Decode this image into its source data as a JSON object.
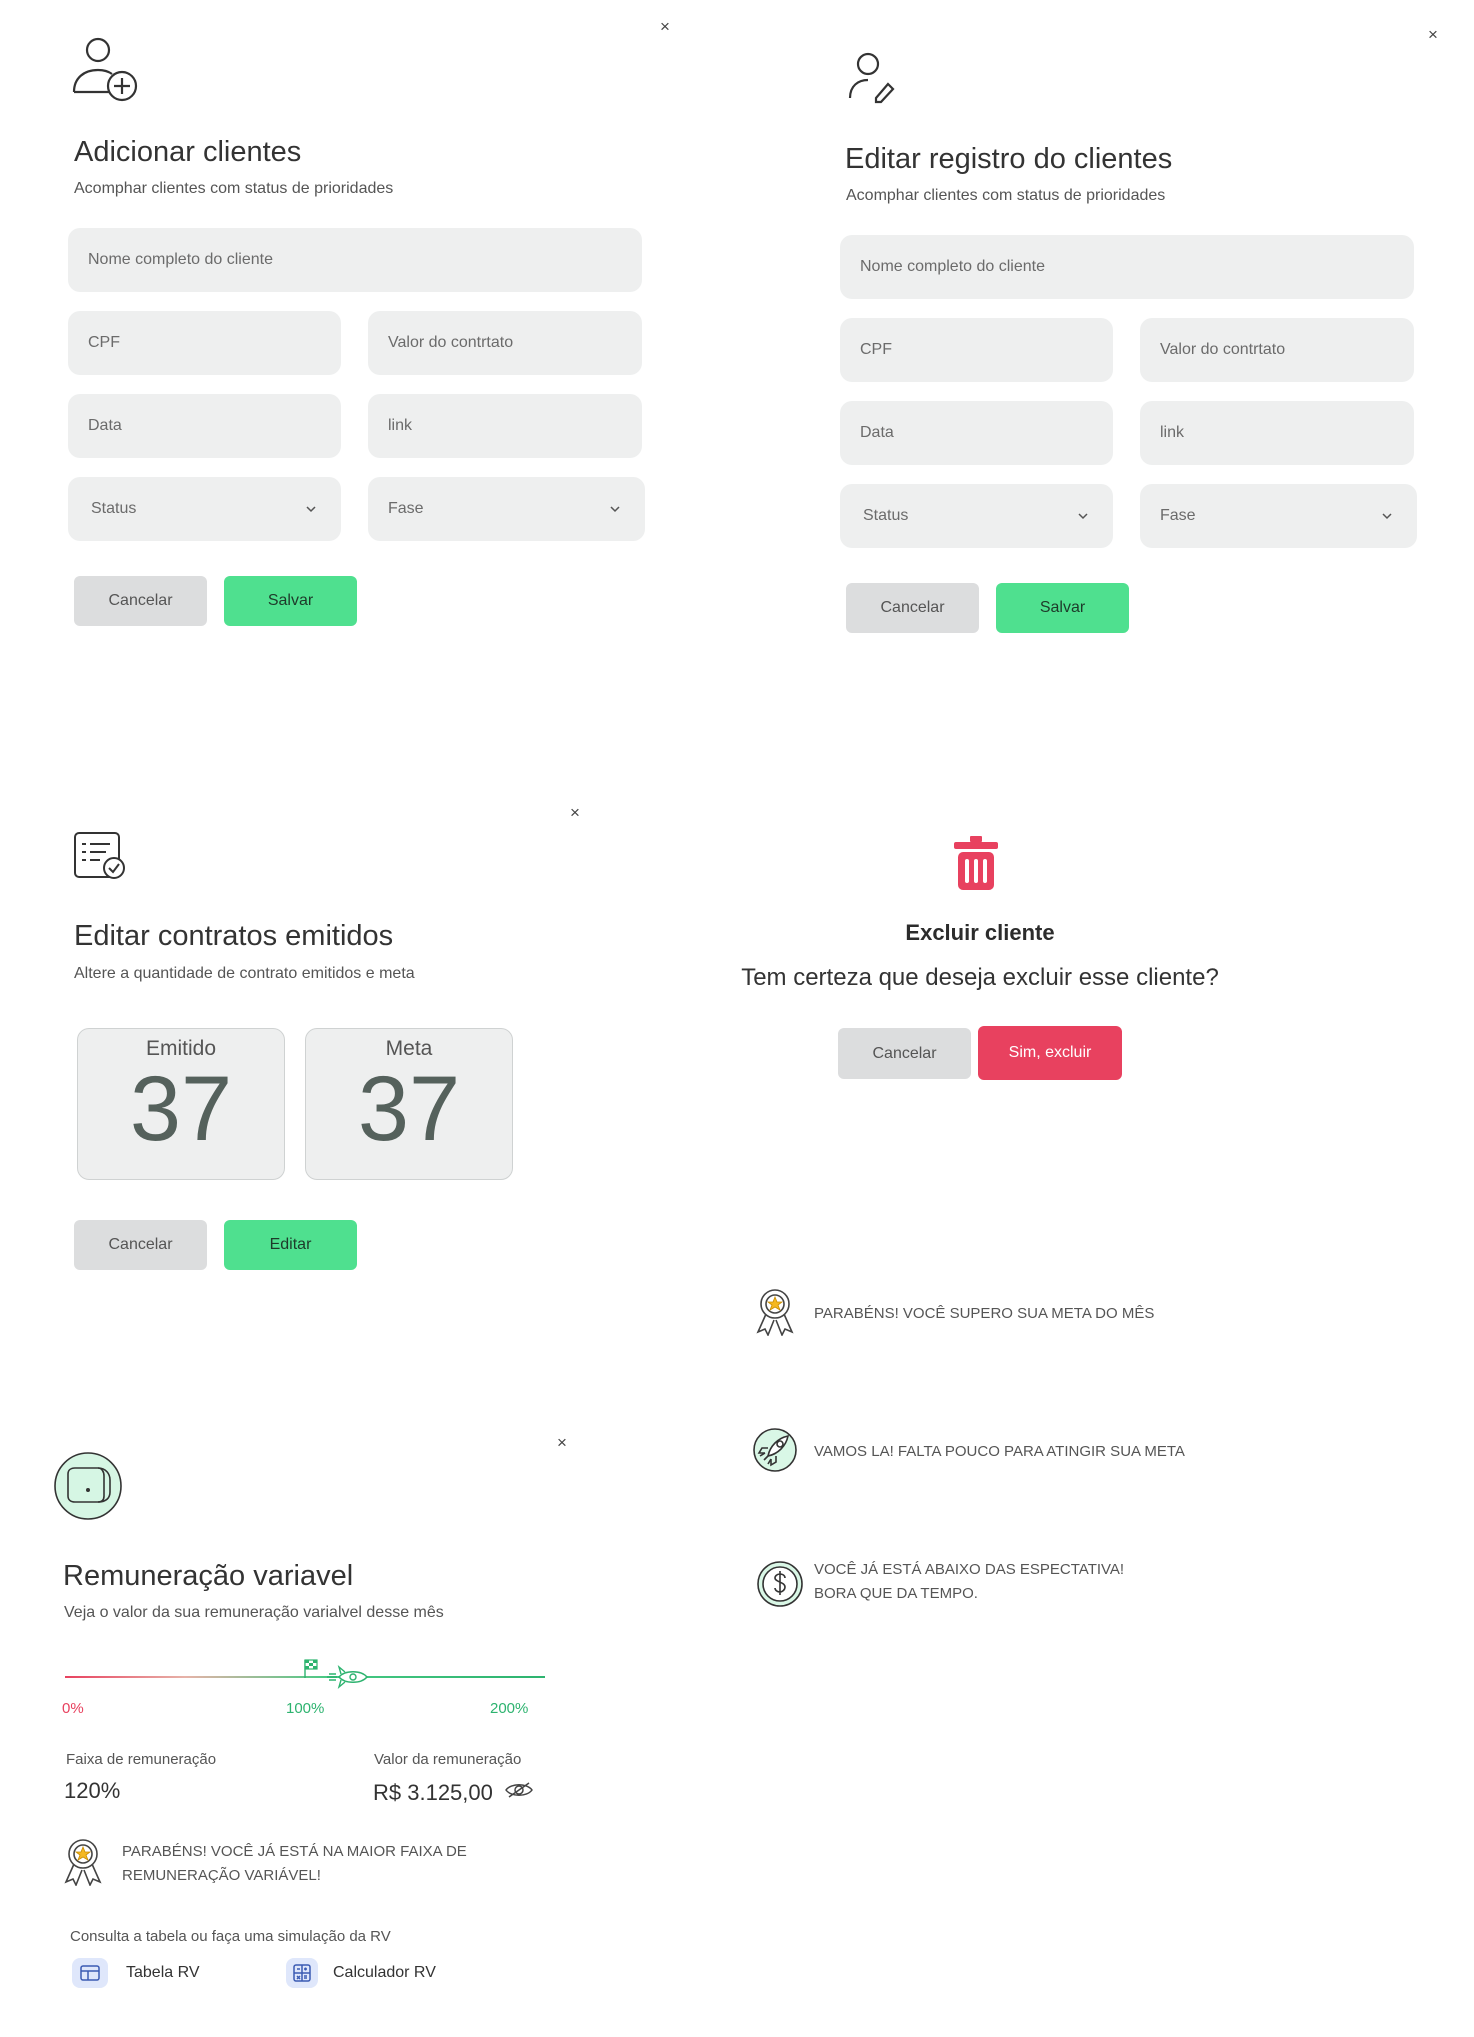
{
  "add_client": {
    "title": "Adicionar clientes",
    "subtitle": "Acomphar clientes com status de prioridades",
    "fields": {
      "name": "Nome completo do cliente",
      "cpf": "CPF",
      "value": "Valor do contrtato",
      "date": "Data",
      "link": "link",
      "status": "Status",
      "phase": "Fase"
    },
    "cancel": "Cancelar",
    "save": "Salvar",
    "close": "×",
    "icon": "user-add-icon"
  },
  "edit_client": {
    "title": "Editar registro do clientes",
    "subtitle": "Acomphar clientes com status de prioridades",
    "fields": {
      "name": "Nome completo do cliente",
      "cpf": "CPF",
      "value": "Valor do contrtato",
      "date": "Data",
      "link": "link",
      "status": "Status",
      "phase": "Fase"
    },
    "cancel": "Cancelar",
    "save": "Salvar",
    "close": "×",
    "icon": "user-edit-icon"
  },
  "contracts": {
    "title": "Editar contratos emitidos",
    "subtitle": "Altere a quantidade de contrato emitidos e meta",
    "issued_label": "Emitido",
    "issued_value": "37",
    "goal_label": "Meta",
    "goal_value": "37",
    "cancel": "Cancelar",
    "edit": "Editar",
    "close": "×",
    "icon": "contract-check-icon"
  },
  "delete_client": {
    "title": "Excluir cliente",
    "question": "Tem certeza que deseja excluir esse cliente?",
    "cancel": "Cancelar",
    "confirm": "Sim, excluir",
    "icon": "trash-icon"
  },
  "messages": [
    {
      "icon": "medal-icon",
      "text": "PARABÉNS! VOCÊ  SUPERO SUA META  DO MÊS"
    },
    {
      "icon": "rocket-icon",
      "text": "VAMOS LA! FALTA POUCO PARA ATINGIR SUA META"
    },
    {
      "icon": "dollar-icon",
      "line1": "VOCÊ JÁ ESTÁ ABAIXO DAS ESPECTATIVA!",
      "line2": "BORA QUE DA TEMPO."
    }
  ],
  "variable_pay": {
    "title": "Remuneração variavel",
    "subtitle": "Veja o valor da sua remuneração varialvel desse mês",
    "progress": {
      "min_label": "0%",
      "mid_label": "100%",
      "max_label": "200%",
      "current_fraction": 0.6
    },
    "range_label": "Faixa de remuneração",
    "range_value": "120%",
    "amount_label": "Valor da remuneração",
    "amount_value": "R$ 3.125,00",
    "congrats_line1": "PARABÉNS! VOCÊ JÁ ESTÁ NA MAIOR FAIXA DE",
    "congrats_line2": "REMUNERAÇÃO VARIÁVEL!",
    "consult_text": "Consulta a tabela ou faça uma simulação da RV",
    "table_link": "Tabela RV",
    "calculator_link": "Calculador RV",
    "close": "×",
    "icon": "wallet-icon"
  },
  "colors": {
    "green": "#4fe08f",
    "red": "#e8415f",
    "field": "#eeefef",
    "accent_green": "#2db36f"
  }
}
